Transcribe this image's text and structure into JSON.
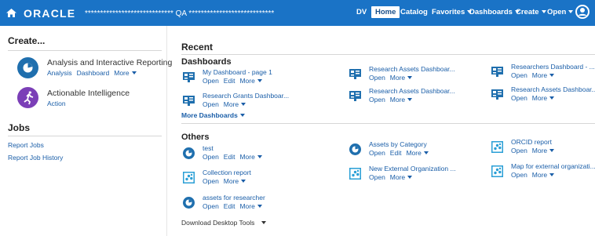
{
  "header": {
    "logo": "ORACLE",
    "title": "***************************** QA ****************************",
    "nav": [
      {
        "label": "DV"
      },
      {
        "label": "Home",
        "active": true
      },
      {
        "label": "Catalog"
      },
      {
        "label": "Favorites"
      },
      {
        "label": "Dashboards"
      },
      {
        "label": "Create"
      },
      {
        "label": "Open"
      }
    ],
    "icons": {
      "home": "home-icon",
      "user": "user-avatar-icon"
    }
  },
  "colors": {
    "topbar": "#1a73c6",
    "link": "#1a5ea8",
    "analysis_icon": "#1f6fae",
    "actionable_icon": "#7b3fb7"
  },
  "sidebar": {
    "create_heading": "Create...",
    "analysis": {
      "title": "Analysis and Interactive Reporting",
      "links": [
        "Analysis",
        "Dashboard",
        "More"
      ]
    },
    "actionable": {
      "title": "Actionable Intelligence",
      "links": [
        "Action"
      ]
    },
    "jobs_heading": "Jobs",
    "jobs": [
      "Report Jobs",
      "Report Job History"
    ]
  },
  "recent": {
    "heading": "Recent",
    "dashboards_heading": "Dashboards",
    "dashboards": [
      {
        "name": "My Dashboard - page 1",
        "actions": [
          "Open",
          "Edit",
          "More"
        ]
      },
      {
        "name": "Research Grants Dashboar...",
        "actions": [
          "Open",
          "More"
        ]
      },
      {
        "name": "Research Assets Dashboar...",
        "actions": [
          "Open",
          "More"
        ]
      },
      {
        "name": "Research Assets Dashboar...",
        "actions": [
          "Open",
          "More"
        ]
      },
      {
        "name": "Researchers Dashboard - ...",
        "actions": [
          "Open",
          "More"
        ]
      },
      {
        "name": "Research Assets Dashboar...",
        "actions": [
          "Open",
          "More"
        ]
      }
    ],
    "more_dashboards": "More Dashboards",
    "others_heading": "Others",
    "others": [
      {
        "name": "test",
        "actions": [
          "Open",
          "Edit",
          "More"
        ],
        "icon": "analysis-icon"
      },
      {
        "name": "Collection report",
        "actions": [
          "Open",
          "More"
        ],
        "icon": "report-icon"
      },
      {
        "name": "assets for researcher",
        "actions": [
          "Open",
          "Edit",
          "More"
        ],
        "icon": "analysis-icon"
      },
      {
        "name": "Assets by Category",
        "actions": [
          "Open",
          "Edit",
          "More"
        ],
        "icon": "analysis-icon"
      },
      {
        "name": "New External Organization ...",
        "actions": [
          "Open",
          "More"
        ],
        "icon": "report-icon"
      },
      {
        "name": "ORCID report",
        "actions": [
          "Open",
          "More"
        ],
        "icon": "report-icon"
      },
      {
        "name": "Map for external organizati...",
        "actions": [
          "Open",
          "More"
        ],
        "icon": "report-icon"
      }
    ],
    "download": "Download Desktop Tools"
  }
}
